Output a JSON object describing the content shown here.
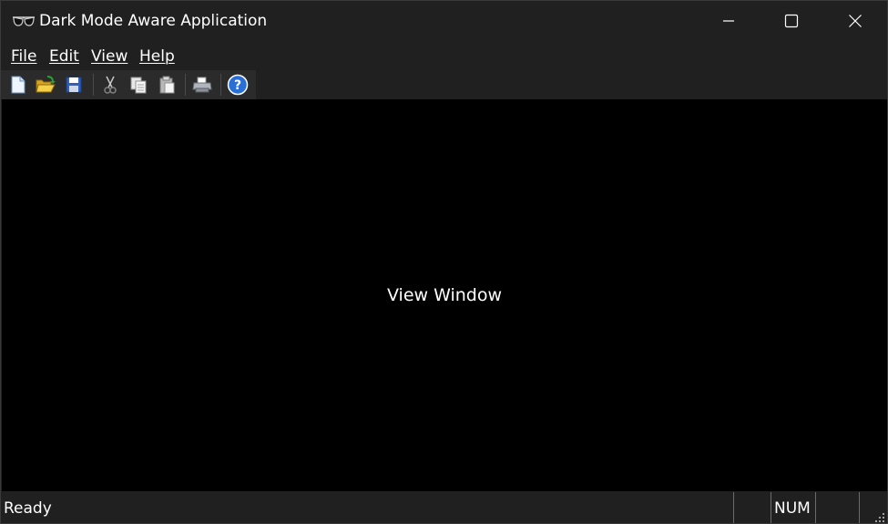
{
  "window": {
    "title": "Dark Mode Aware Application",
    "icon": "sunglasses-icon",
    "caption_buttons": [
      "minimize-icon",
      "maximize-icon",
      "close-icon"
    ]
  },
  "menu": {
    "items": [
      {
        "label": "File"
      },
      {
        "label": "Edit"
      },
      {
        "label": "View"
      },
      {
        "label": "Help"
      }
    ]
  },
  "toolbar": {
    "buttons": [
      {
        "icon": "new-document-icon"
      },
      {
        "icon": "open-folder-icon"
      },
      {
        "icon": "save-icon"
      },
      {
        "icon": "cut-icon"
      },
      {
        "icon": "copy-icon"
      },
      {
        "icon": "paste-icon"
      },
      {
        "icon": "print-icon"
      },
      {
        "icon": "help-icon"
      }
    ]
  },
  "view": {
    "label": "View Window"
  },
  "status": {
    "text": "Ready",
    "num_indicator": "NUM"
  },
  "colors": {
    "chrome": "#202020",
    "view_background": "#000000",
    "text": "#ffffff"
  }
}
